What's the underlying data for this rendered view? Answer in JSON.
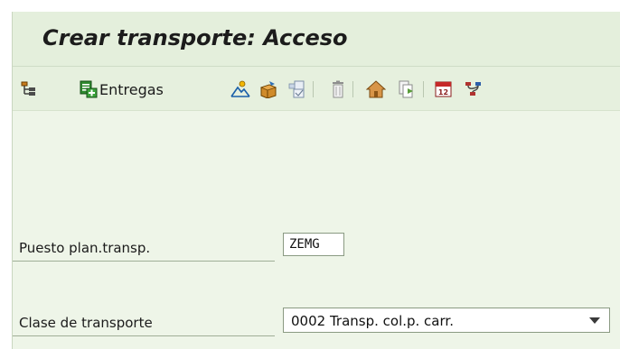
{
  "window": {
    "title": "Crear transporte: Acceso"
  },
  "toolbar": {
    "items": [
      {
        "name": "hierarchy-icon"
      },
      {
        "name": "deliveries-icon",
        "label": "Entregas"
      },
      {
        "name": "mountain-icon"
      },
      {
        "name": "package-icon"
      },
      {
        "name": "copy-layout-icon"
      },
      {
        "name": "trash-icon"
      },
      {
        "name": "home-icon"
      },
      {
        "name": "document-forward-icon"
      },
      {
        "name": "calendar-icon"
      },
      {
        "name": "network-icon"
      }
    ],
    "entregas_label": "Entregas"
  },
  "form": {
    "puesto_label": "Puesto plan.transp.",
    "puesto_value": "ZEMG",
    "clase_label": "Clase de transporte",
    "clase_value": "0002 Transp. col.p. carr."
  },
  "colors": {
    "title_bar": "#e4efdc",
    "toolbar": "#e6f0de",
    "body": "#eef5e8"
  }
}
